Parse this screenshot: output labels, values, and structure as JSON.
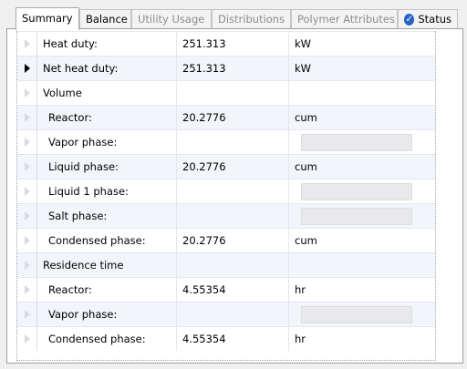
{
  "tabs": [
    {
      "label": "Summary",
      "active": true,
      "disabled": false
    },
    {
      "label": "Balance",
      "active": false,
      "disabled": false
    },
    {
      "label": "Utility Usage",
      "active": false,
      "disabled": true
    },
    {
      "label": "Distributions",
      "active": false,
      "disabled": true
    },
    {
      "label": "Polymer Attributes",
      "active": false,
      "disabled": true
    },
    {
      "label": "Status",
      "active": false,
      "disabled": false,
      "icon": "check-icon"
    }
  ],
  "rows": [
    {
      "label": "Heat duty:",
      "value": "251.313",
      "unit": "kW"
    },
    {
      "label": "Net heat duty:",
      "value": "251.313",
      "unit": "kW",
      "selected": true
    },
    {
      "label": "Volume",
      "value": "",
      "unit": "",
      "header": true
    },
    {
      "label": "Reactor:",
      "value": "20.2776",
      "unit": "cum"
    },
    {
      "label": "Vapor phase:",
      "value": "",
      "unit": ""
    },
    {
      "label": "Liquid phase:",
      "value": "20.2776",
      "unit": "cum"
    },
    {
      "label": "Liquid 1 phase:",
      "value": "",
      "unit": ""
    },
    {
      "label": "Salt phase:",
      "value": "",
      "unit": ""
    },
    {
      "label": "Condensed phase:",
      "value": "20.2776",
      "unit": "cum"
    },
    {
      "label": "Residence time",
      "value": "",
      "unit": "",
      "header": true
    },
    {
      "label": "Reactor:",
      "value": "4.55354",
      "unit": "hr"
    },
    {
      "label": "Vapor phase:",
      "value": "",
      "unit": ""
    },
    {
      "label": "Condensed phase:",
      "value": "4.55354",
      "unit": "hr"
    }
  ]
}
